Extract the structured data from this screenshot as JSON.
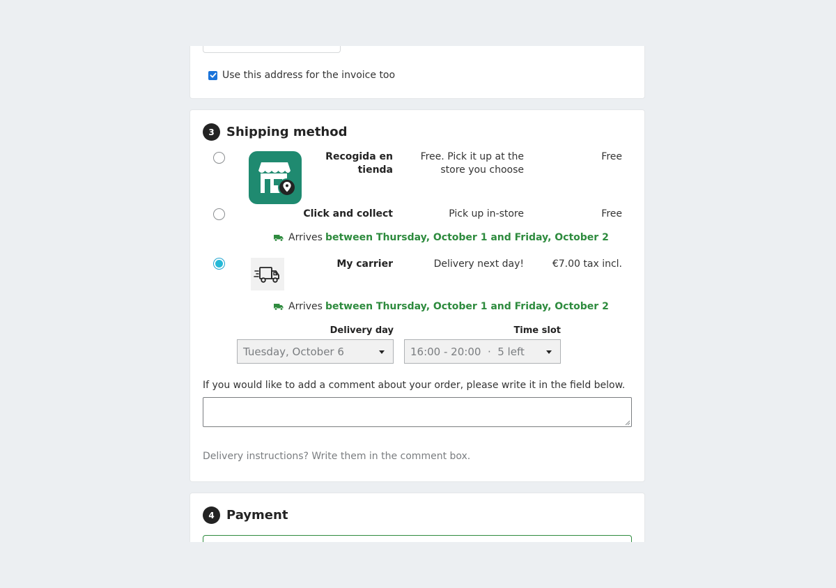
{
  "address": {
    "invoice_checkbox_label": "Use this address for the invoice too",
    "invoice_checkbox_checked": true
  },
  "shipping": {
    "step_number": "3",
    "title": "Shipping method",
    "carriers": [
      {
        "name_line1": "Recogida en",
        "name_line2": "tienda",
        "delay_line1": "Free. Pick it up at the",
        "delay_line2": "store you choose",
        "price": "Free",
        "selected": false,
        "logo": "store-location-icon"
      },
      {
        "name": "Click and collect",
        "delay": "Pick up in-store",
        "price": "Free",
        "selected": false,
        "arrives_prefix": "Arrives",
        "arrives_dates": "between Thursday, October 1 and Friday, October 2"
      },
      {
        "name": "My carrier",
        "delay": "Delivery next day!",
        "price": "€7.00 tax incl.",
        "selected": true,
        "logo": "delivery-truck-icon",
        "arrives_prefix": "Arrives",
        "arrives_dates": "between Thursday, October 1 and Friday, October 2"
      }
    ],
    "delivery_day_label": "Delivery day",
    "delivery_day_value": "Tuesday, October 6",
    "time_slot_label": "Time slot",
    "time_slot_value": "16:00 - 20:00  ·  5 left",
    "comment_label": "If you would like to add a comment about your order, please write it in the field below.",
    "comment_value": "",
    "hint": "Delivery instructions? Write them in the comment box."
  },
  "payment": {
    "step_number": "4",
    "title": "Payment"
  },
  "colors": {
    "accent_green": "#2e8b3e",
    "radio_selected": "#25b9d7",
    "store_logo_bg": "#1f8a70",
    "checkbox_blue": "#1a73d9"
  }
}
